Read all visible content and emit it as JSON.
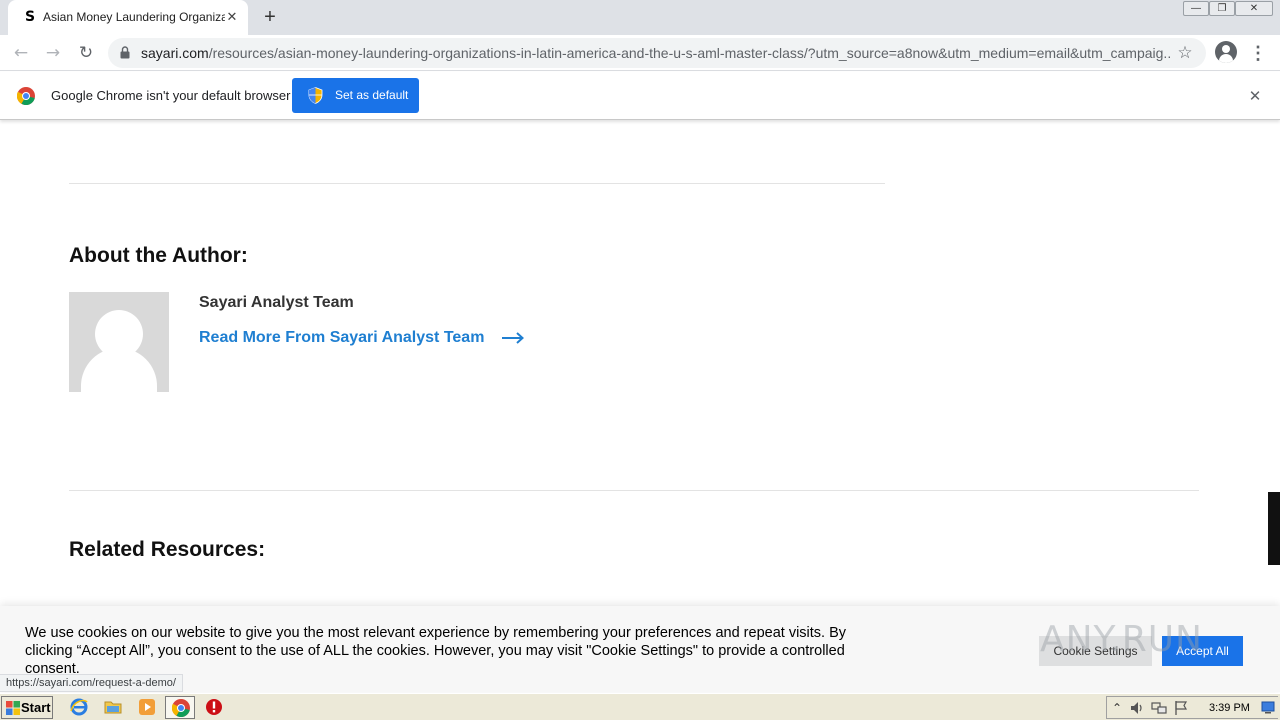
{
  "browser": {
    "tab": {
      "favicon_letter": "S",
      "title": "Asian Money Laundering Organizatio",
      "close_glyph": "✕"
    },
    "new_tab_glyph": "+",
    "window_controls": {
      "minimize": "—",
      "restore": "❐",
      "close": "✕"
    },
    "toolbar": {
      "back_glyph": "←",
      "forward_glyph": "→",
      "reload_glyph": "↻",
      "url_host": "sayari.com",
      "url_path": "/resources/asian-money-laundering-organizations-in-latin-america-and-the-u-s-aml-master-class/?utm_source=a8now&utm_medium=email&utm_campaig...",
      "bookmark_glyph": "☆",
      "menu_glyph": "⋮"
    },
    "infobar": {
      "message": "Google Chrome isn't your default browser",
      "button_label": "Set as default",
      "close_glyph": "✕"
    },
    "status_url": "https://sayari.com/request-a-demo/"
  },
  "page": {
    "about_heading": "About the Author:",
    "author_name": "Sayari Analyst Team",
    "author_link": "Read More From Sayari Analyst Team",
    "related_heading": "Related Resources:"
  },
  "cookie_banner": {
    "text": "We use cookies on our website to give you the most relevant experience by remembering your preferences and repeat visits. By clicking “Accept All”, you consent to the use of ALL the cookies. However, you may visit \"Cookie Settings\" to provide a controlled consent.",
    "settings_label": "Cookie Settings",
    "accept_label": "Accept All",
    "watermark": "ANY.RUN"
  },
  "taskbar": {
    "start_label": "Start",
    "clock": "3:39 PM",
    "tray_up_glyph": "⌃"
  },
  "colors": {
    "accent_blue": "#1a73e8",
    "link_blue": "#1f7fd1",
    "tab_strip": "#dee1e6",
    "taskbar": "#ece9d8"
  },
  "icons": [
    "sayari-favicon",
    "back-arrow-icon",
    "forward-arrow-icon",
    "reload-icon",
    "lock-icon",
    "star-icon",
    "profile-icon",
    "kebab-menu-icon",
    "chrome-logo-icon",
    "shield-icon",
    "close-icon",
    "arrow-right-icon",
    "avatar-placeholder",
    "windows-flag-icon",
    "ie-icon",
    "folder-icon",
    "media-player-icon",
    "chrome-icon",
    "opera-icon",
    "speaker-icon",
    "network-icon",
    "flag-icon",
    "show-desktop-icon"
  ]
}
